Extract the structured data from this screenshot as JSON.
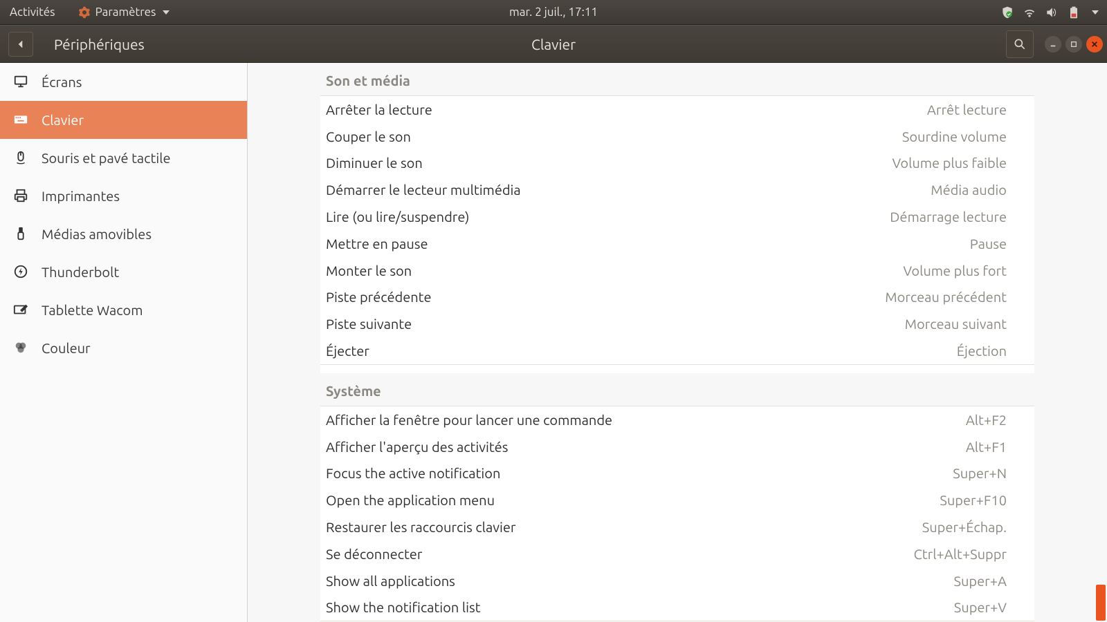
{
  "top_panel": {
    "activities": "Activités",
    "app_menu": "Paramètres",
    "datetime": "mar.  2 juil., 17:11"
  },
  "titlebar": {
    "back_target": "Périphériques",
    "window_title": "Clavier"
  },
  "sidebar": {
    "items": [
      {
        "id": "displays",
        "label": "Écrans",
        "icon": "monitor"
      },
      {
        "id": "keyboard",
        "label": "Clavier",
        "icon": "keyboard",
        "selected": true
      },
      {
        "id": "mouse-touchpad",
        "label": "Souris et pavé tactile",
        "icon": "mouse"
      },
      {
        "id": "printers",
        "label": "Imprimantes",
        "icon": "printer"
      },
      {
        "id": "removable-media",
        "label": "Médias amovibles",
        "icon": "usb"
      },
      {
        "id": "thunderbolt",
        "label": "Thunderbolt",
        "icon": "bolt"
      },
      {
        "id": "wacom",
        "label": "Tablette Wacom",
        "icon": "tablet"
      },
      {
        "id": "color",
        "label": "Couleur",
        "icon": "color"
      }
    ]
  },
  "sections": [
    {
      "id": "sound-media",
      "title": "Son et média",
      "rows": [
        {
          "label": "Arrêter la lecture",
          "value": "Arrêt lecture"
        },
        {
          "label": "Couper le son",
          "value": "Sourdine volume"
        },
        {
          "label": "Diminuer le son",
          "value": "Volume plus faible"
        },
        {
          "label": "Démarrer le lecteur multimédia",
          "value": "Média audio"
        },
        {
          "label": "Lire (ou lire/suspendre)",
          "value": "Démarrage lecture"
        },
        {
          "label": "Mettre en pause",
          "value": "Pause"
        },
        {
          "label": "Monter le son",
          "value": "Volume plus fort"
        },
        {
          "label": "Piste précédente",
          "value": "Morceau précédent"
        },
        {
          "label": "Piste suivante",
          "value": "Morceau suivant"
        },
        {
          "label": "Éjecter",
          "value": "Éjection"
        }
      ]
    },
    {
      "id": "system",
      "title": "Système",
      "rows": [
        {
          "label": "Afficher la fenêtre pour lancer une commande",
          "value": "Alt+F2"
        },
        {
          "label": "Afficher l'aperçu des activités",
          "value": "Alt+F1"
        },
        {
          "label": "Focus the active notification",
          "value": "Super+N"
        },
        {
          "label": "Open the application menu",
          "value": "Super+F10"
        },
        {
          "label": "Restaurer les raccourcis clavier",
          "value": "Super+Échap."
        },
        {
          "label": "Se déconnecter",
          "value": "Ctrl+Alt+Suppr"
        },
        {
          "label": "Show all applications",
          "value": "Super+A"
        },
        {
          "label": "Show the notification list",
          "value": "Super+V"
        }
      ]
    }
  ]
}
